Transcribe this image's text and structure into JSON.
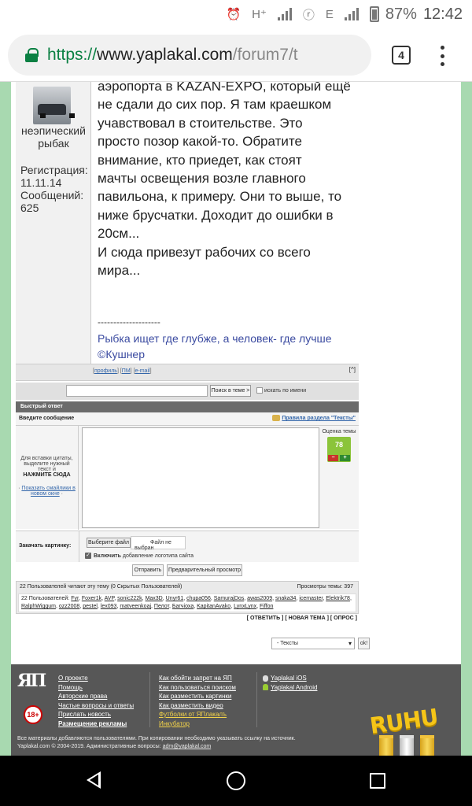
{
  "status_bar": {
    "network_h": "H⁺",
    "network_e": "E",
    "battery": "87%",
    "time": "12:42"
  },
  "browser": {
    "url_scheme": "https://",
    "url_host": "www.yaplakal.com",
    "url_path": "/forum7/t",
    "tab_count": "4"
  },
  "post": {
    "author": "неэпический рыбак",
    "reg_label": "Регистрация:",
    "reg_date": "11.11.14",
    "msgs_label": "Сообщений:",
    "msgs_count": "625",
    "text_lines": [
      "аэропорта в KAZAN-EXPO, который ещё",
      "не сдали до сих пор. Я там краешком",
      "учавствовал в стоительстве. Это",
      "просто позор какой-то. Обратите",
      "внимание, кто приедет, как стоят",
      "мачты освещения возле главного",
      "павильона, к примеру. Они то выше, то",
      "ниже брусчатки. Доходит до ошибки в",
      "20см...",
      "И сюда привезут рабочих со всего",
      "мира..."
    ],
    "signature_line": "--------------------",
    "signature_text": "Рыбка ищет где глубже, а человек- где лучше ©Кушнер",
    "foot_profile": "профиль",
    "foot_pm": "ПМ",
    "foot_email": "e-mail",
    "foot_top": "[^]"
  },
  "search": {
    "button": "Поиск в теме >",
    "checkbox_label": "искать по имени"
  },
  "quick_reply": {
    "header": "Быстрый ответ",
    "enter_msg": "Введите сообщение",
    "rules_link": "Правила раздела \"Тексты\"",
    "hint_1": "Для вставки цитаты, выделите нужный текст и",
    "hint_click": "НАЖМИТЕ СЮДА",
    "smiles_link": "Показать смайлики в новом окне",
    "rating_label": "Оценка темы",
    "rating_value": "78",
    "rating_minus": "−",
    "rating_plus": "+",
    "upload_label": "Закачать картинку:",
    "file_button": "Выберите файл",
    "file_name": "Файл не выбран",
    "logo_on": "Включить",
    "logo_text": "добавление логотипа сайта",
    "send_button": "Отправить",
    "preview_button": "Предварительный просмотр"
  },
  "users": {
    "reading": "22 Пользователей читают эту тему (0 Скрытых Пользователей)",
    "views": "Просмотры темы: 397",
    "list_prefix": "22 Пользователей:",
    "names": [
      "Fyr",
      "Foxer1k",
      "AVP",
      "sonic222k",
      "Max3D",
      "Unyr61",
      "chupa056",
      "SamurajDos",
      "awas2009",
      "snaka34",
      "icemaster",
      "Elektrik78",
      "RalphWiggum",
      "ozz2008",
      "pestel",
      "lex093",
      "matveenkoaj",
      "Пелот",
      "Бaгчiоха",
      "KapitanAvako",
      "LynxLynx",
      "Fiffon"
    ]
  },
  "thread_actions": "[ ОТВЕТИТЬ ] [ НОВАЯ ТЕМА ] [ ОПРОС ]",
  "forum_select": {
    "value": "- Тексты",
    "ok": "ok!"
  },
  "footer": {
    "logo": "ЯП",
    "age": "18+",
    "col1": [
      "О проекте",
      "Помощь",
      "Авторские права",
      "Частые вопросы и ответы",
      "Прислать новость",
      "Размещение рекламы"
    ],
    "col2": [
      "Как обойти запрет на ЯП",
      "Как пользоваться поиском",
      "Как разместить картинки",
      "Как разместить видео",
      "Футболки от ЯПлакалъ",
      "Инкубатор"
    ],
    "col3": [
      "Yaplakal iOS",
      "Yaplakal Android"
    ],
    "disclaimer_1": "Все материалы добавляются пользователями. При копировании необходимо указывать ссылку на источник.",
    "disclaimer_2": "Yaplakal.com © 2004-2019. Административные вопросы:",
    "admin_email": "adm@yaplakal.com",
    "ruhu": "RUHU"
  }
}
